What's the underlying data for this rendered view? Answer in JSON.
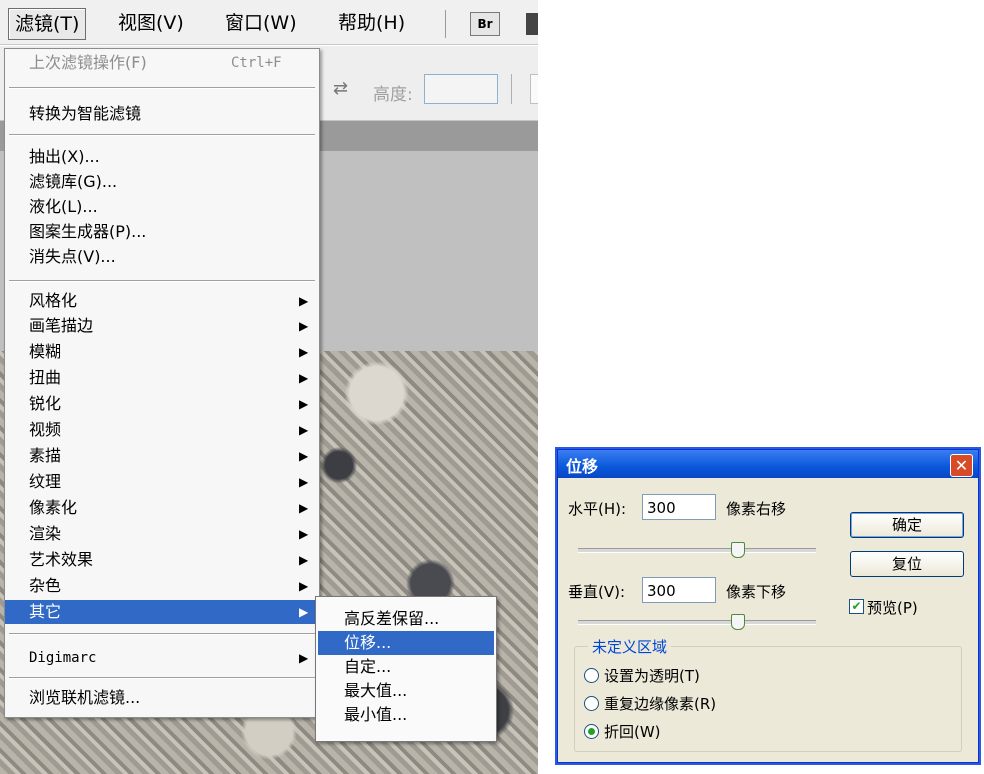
{
  "menubar": {
    "items": [
      "滤镜(T)",
      "视图(V)",
      "窗口(W)",
      "帮助(H)"
    ],
    "br_label": "Br"
  },
  "options_bar": {
    "height_label": "高度:",
    "swap_icon": "swap-arrows-icon"
  },
  "filter_menu": {
    "last_filter": {
      "label": "上次滤镜操作(F)",
      "shortcut": "Ctrl+F"
    },
    "smart_filter": "转换为智能滤镜",
    "group1": [
      "抽出(X)...",
      "滤镜库(G)...",
      "液化(L)...",
      "图案生成器(P)...",
      "消失点(V)..."
    ],
    "submenus": [
      "风格化",
      "画笔描边",
      "模糊",
      "扭曲",
      "锐化",
      "视频",
      "素描",
      "纹理",
      "像素化",
      "渲染",
      "艺术效果",
      "杂色",
      "其它"
    ],
    "digimarc": "Digimarc",
    "browse_online": "浏览联机滤镜...",
    "submenu_arrow": "▶"
  },
  "other_submenu": {
    "items": [
      "高反差保留...",
      "位移...",
      "自定...",
      "最大值...",
      "最小值..."
    ],
    "highlighted_index": 1
  },
  "offset_dialog": {
    "title": "位移",
    "close_symbol": "✕",
    "horizontal_label": "水平(H):",
    "horizontal_value": "300",
    "horizontal_unit": "像素右移",
    "vertical_label": "垂直(V):",
    "vertical_value": "300",
    "vertical_unit": "像素下移",
    "ok_label": "确定",
    "reset_label": "复位",
    "preview_label": "预览(P)",
    "preview_checked": true,
    "undefined_area_label": "未定义区域",
    "options": [
      "设置为透明(T)",
      "重复边缘像素(R)",
      "折回(W)"
    ],
    "selected_option": 2,
    "horizontal_slider_level": 0.67,
    "vertical_slider_level": 0.67
  },
  "colors": {
    "highlight": "#3169c6",
    "dialog_title": "#0a58da",
    "dialog_bg": "#ece9d8",
    "group_legend": "#0046d5"
  }
}
